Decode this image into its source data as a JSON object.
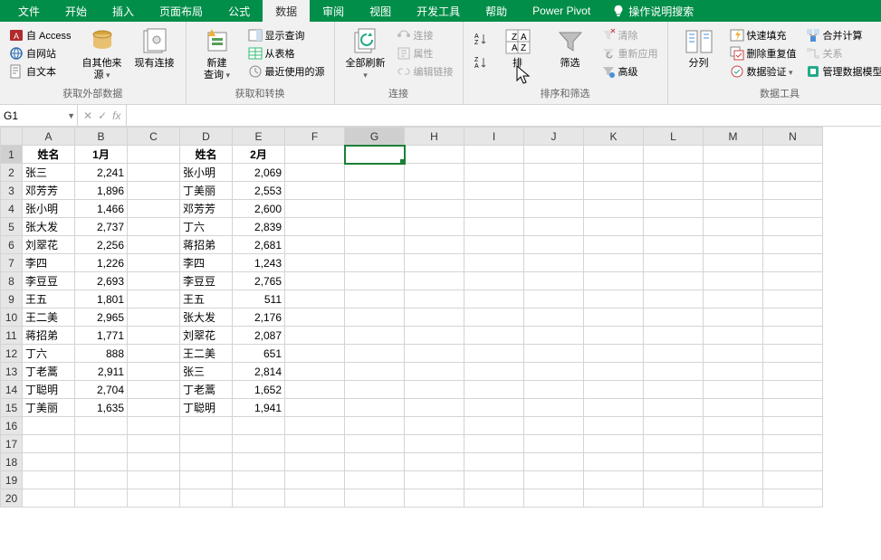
{
  "tabs": {
    "file": "文件",
    "home": "开始",
    "insert": "插入",
    "pagelayout": "页面布局",
    "formulas": "公式",
    "data": "数据",
    "review": "审阅",
    "view": "视图",
    "dev": "开发工具",
    "help": "帮助",
    "powerpivot": "Power Pivot",
    "tellme": "操作说明搜索"
  },
  "ribbon": {
    "get_ext": {
      "access": "自 Access",
      "web": "自网站",
      "text": "自文本",
      "other": "自其他来源",
      "existing": "现有连接",
      "group": "获取外部数据"
    },
    "get_trans": {
      "newquery": "新建\n查询",
      "showqueries": "显示查询",
      "fromtable": "从表格",
      "recent": "最近使用的源",
      "group": "获取和转换"
    },
    "conn": {
      "refresh": "全部刷新",
      "connections": "连接",
      "properties": "属性",
      "editlinks": "编辑链接",
      "group": "连接"
    },
    "sort": {
      "sort": "排",
      "filter": "筛选",
      "clear": "清除",
      "reapply": "重新应用",
      "advanced": "高级",
      "group": "排序和筛选"
    },
    "tools": {
      "texttocol": "分列",
      "flashfill": "快速填充",
      "removedup": "删除重复值",
      "validation": "数据验证",
      "consolidate": "合并计算",
      "relationships": "关系",
      "datamodel": "管理数据模型",
      "group": "数据工具"
    }
  },
  "namebox": "G1",
  "headers": {
    "name": "姓名",
    "m1": "1月",
    "m2": "2月"
  },
  "cols": [
    "A",
    "B",
    "C",
    "D",
    "E",
    "F",
    "G",
    "H",
    "I",
    "J",
    "K",
    "L",
    "M",
    "N"
  ],
  "rows_left": [
    {
      "name": "张三",
      "val": "2,241"
    },
    {
      "name": "邓芳芳",
      "val": "1,896"
    },
    {
      "name": "张小明",
      "val": "1,466"
    },
    {
      "name": "张大发",
      "val": "2,737"
    },
    {
      "name": "刘翠花",
      "val": "2,256"
    },
    {
      "name": "李四",
      "val": "1,226"
    },
    {
      "name": "李豆豆",
      "val": "2,693"
    },
    {
      "name": "王五",
      "val": "1,801"
    },
    {
      "name": "王二美",
      "val": "2,965"
    },
    {
      "name": "蒋招弟",
      "val": "1,771"
    },
    {
      "name": "丁六",
      "val": "888"
    },
    {
      "name": "丁老蒿",
      "val": "2,911"
    },
    {
      "name": "丁聪明",
      "val": "2,704"
    },
    {
      "name": "丁美丽",
      "val": "1,635"
    }
  ],
  "rows_right": [
    {
      "name": "张小明",
      "val": "2,069"
    },
    {
      "name": "丁美丽",
      "val": "2,553"
    },
    {
      "name": "邓芳芳",
      "val": "2,600"
    },
    {
      "name": "丁六",
      "val": "2,839"
    },
    {
      "name": "蒋招弟",
      "val": "2,681"
    },
    {
      "name": "李四",
      "val": "1,243"
    },
    {
      "name": "李豆豆",
      "val": "2,765"
    },
    {
      "name": "王五",
      "val": "511"
    },
    {
      "name": "张大发",
      "val": "2,176"
    },
    {
      "name": "刘翠花",
      "val": "2,087"
    },
    {
      "name": "王二美",
      "val": "651"
    },
    {
      "name": "张三",
      "val": "2,814"
    },
    {
      "name": "丁老蒿",
      "val": "1,652"
    },
    {
      "name": "丁聪明",
      "val": "1,941"
    }
  ]
}
